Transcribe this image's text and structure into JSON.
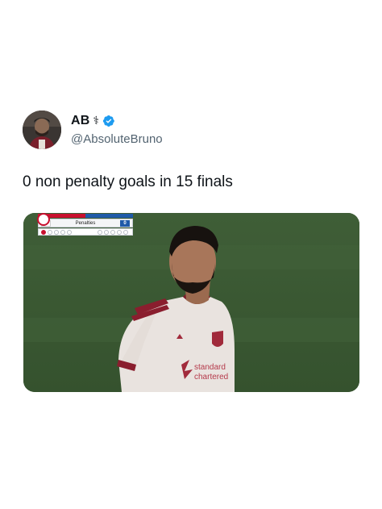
{
  "author": {
    "name": "AB",
    "name_emoji": "⚕",
    "handle": "@AbsoluteBruno",
    "verified_color": "#1d9bf0"
  },
  "tweet": {
    "text": "0 non penalty goals in 15 finals"
  },
  "media": {
    "scoreboard": {
      "home_score": "0",
      "label": "Penalties",
      "away_score": "0",
      "home_color": "#c8102e",
      "away_color": "#1f5aa8"
    },
    "kit_sponsor_line1": "standard",
    "kit_sponsor_line2": "chartered"
  },
  "icons": {
    "verified": "verified-badge-icon",
    "emoji": "medical-symbol-icon"
  }
}
